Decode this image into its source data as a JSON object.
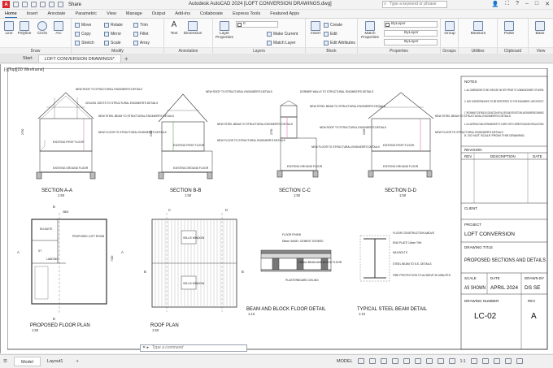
{
  "titlebar": {
    "app_logo": "A",
    "share": "Share",
    "title": "Autodesk AutoCAD 2024    [LOFT CONVERSION DRAWINGS.dwg]",
    "search_placeholder": "Type a keyword or phrase"
  },
  "ribbon_tabs": [
    "Home",
    "Insert",
    "Annotate",
    "Parametric",
    "View",
    "Manage",
    "Output",
    "Add-ins",
    "Collaborate",
    "Express Tools",
    "Featured Apps"
  ],
  "ribbon": {
    "draw": {
      "label": "Draw",
      "tools": [
        "Line",
        "Polyline",
        "Circle",
        "Arc"
      ]
    },
    "modify": {
      "label": "Modify",
      "tools": [
        "Move",
        "Rotate",
        "Trim",
        "Copy",
        "Mirror",
        "Fillet",
        "Stretch",
        "Scale",
        "Array"
      ]
    },
    "annotation": {
      "label": "Annotation",
      "tools": [
        "Text",
        "Dimension"
      ]
    },
    "layers": {
      "label": "Layers",
      "tools": [
        "Layer Properties",
        "Make Current",
        "Match Layer"
      ],
      "current_layer": "0"
    },
    "block": {
      "label": "Block",
      "tools": [
        "Insert",
        "Create",
        "Edit",
        "Edit Attributes"
      ]
    },
    "properties": {
      "label": "Properties",
      "tools": [
        "Match Properties"
      ],
      "color": "ByLayer",
      "linetype": "ByLayer",
      "lineweight": "ByLayer"
    },
    "groups": {
      "label": "Groups",
      "tools": [
        "Group"
      ]
    },
    "utilities": {
      "label": "Utilities",
      "tools": [
        "Measure"
      ]
    },
    "clipboard": {
      "label": "Clipboard",
      "tools": [
        "Paste"
      ]
    },
    "view": {
      "label": "View",
      "tools": [
        "Base"
      ]
    }
  },
  "file_tabs": {
    "start": "Start",
    "active": "LOFT CONVERSION DRAWINGS*"
  },
  "viewport_label": "[-][Top][2D Wireframe]",
  "drawings": {
    "section_a": {
      "title": "SECTION A-A",
      "scale": "1:50"
    },
    "section_b": {
      "title": "SECTION B-B",
      "scale": "1:50"
    },
    "section_c": {
      "title": "SECTION C-C",
      "scale": "1:50"
    },
    "section_d": {
      "title": "SECTION D-D",
      "scale": "1:50"
    },
    "floor_plan": {
      "title": "PROPOSED FLOOR PLAN",
      "scale": "1:50"
    },
    "roof_plan": {
      "title": "ROOF PLAN",
      "scale": "1:50"
    },
    "beam_block": {
      "title": "BEAM AND BLOCK FLOOR DETAIL",
      "scale": "1:10"
    },
    "steel_beam": {
      "title": "TYPICAL STEEL BEAM DETAIL",
      "scale": "1:10"
    }
  },
  "annotations": {
    "new_roof": "NEW ROOF TO STRUCTURAL ENGINEER'S DETAILS",
    "ceiling_joists": "CEILING JOISTS TO STRUCTURAL ENGINEER'S DETAILS",
    "new_steel_beam": "NEW STEEL BEAM TO STRUCTURAL ENGINEER'S DETAILS",
    "new_floor": "NEW FLOOR TO STRUCTURAL ENGINEER'S DETAILS",
    "existing_first_floor": "EXISTING FIRST FLOOR",
    "existing_ground_floor": "EXISTING GROUND FLOOR",
    "dormer_walls": "DORMER WALLS TO STRUCTURAL ENGINEER'S DETAILS",
    "floor_finish": "FLOOR FINISH",
    "screed": "65mm SAND / CEMENT SCREED",
    "beam_block_floor": "150mm BEAM AND BLOCK FLOOR",
    "plasterboard": "PLASTERBOARD CEILING",
    "floor_construction": "FLOOR CONSTRUCTION ABOVE",
    "end_plate": "END PLATE 10mm THK",
    "bolts": "M16 BOLTS",
    "steel_beam_se": "STEEL BEAM TO S.E. DETAILS",
    "fire_protection": "FIRE PROTECTION TO ACHIEVE 30 MINUTES",
    "en_suite": "EN-SUITE",
    "proposed_loft_room": "PROPOSED LOFT ROOM",
    "landing": "LANDING",
    "st": "ST",
    "velux_1": "VELUX WINDOW",
    "velux_2": "VELUX WINDOW",
    "dim_1": "2700",
    "dim_2": "2400",
    "dim_3": "2700",
    "dim_4": "2400",
    "dim_5": "3800",
    "dim_6": "7400"
  },
  "section_markers": {
    "a": "A",
    "b": "B",
    "c": "C",
    "d": "D"
  },
  "notes": {
    "heading": "NOTES",
    "items": [
      "1.  ALL DIMENSIONS TO BE CHECKED ON SITE PRIOR TO COMMENCEMENT OF WORK.",
      "2.  ANY DISCREPANCIES TO BE REPORTED TO THE ENGINEER / ARCHITECT.",
      "3.  THIS DRAWING TO BE READ IN CONJUNCTION WITH ALL RELEVANT ARCHITECTURAL AND ENGINEERING DRAWINGS.",
      "4.  ALL MATERIALS AND WORKMANSHIP TO COMPLY WITH CURRENT BUILDING REGULATIONS.",
      "5.  DO NOT SCALE FROM THIS DRAWING."
    ]
  },
  "title_block": {
    "revision_heading": "REVISION",
    "rev_col": "REV",
    "description_col": "DESCRIPTION",
    "date_col": "DATE",
    "client_label": "CLIENT",
    "project_label": "PROJECT",
    "project": "LOFT CONVERSION",
    "drawing_title_label": "DRAWING TITLE",
    "drawing_title": "PROPOSED SECTIONS AND DETAILS",
    "scale_label": "SCALE",
    "scale": "AS SHOWN",
    "date_label": "DATE",
    "date": "APRIL 2024",
    "drawn_by_label": "DRAWN BY",
    "drawn_by": "DS SE",
    "drawing_number_label": "DRAWING NUMBER",
    "drawing_number": "LC-02",
    "rev_label": "REV",
    "rev": "A"
  },
  "command_line": {
    "prompt": "Type a command"
  },
  "statusbar": {
    "tabs": [
      "Model",
      "Layout1"
    ],
    "model_label": "MODEL",
    "zoom": "1:1"
  }
}
